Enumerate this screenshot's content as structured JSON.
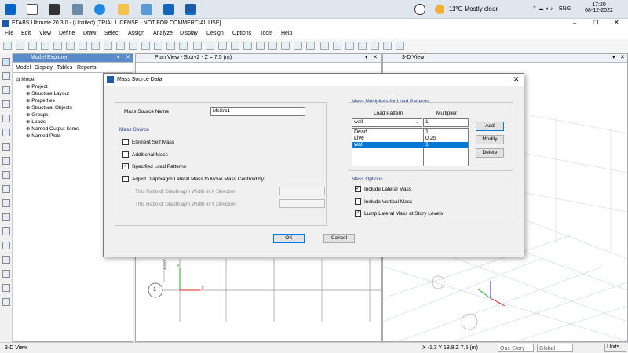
{
  "taskbar": {
    "weather": "11°C  Mostly clear",
    "language": "ENG",
    "time": "17:20",
    "date": "08-12-2022"
  },
  "window": {
    "title": "ETABS Ultimate 20.3.0 - (Untitled)  [TRIAL LICENSE - NOT FOR COMMERCIAL USE]"
  },
  "menu": [
    "File",
    "Edit",
    "View",
    "Define",
    "Draw",
    "Select",
    "Assign",
    "Analyze",
    "Display",
    "Design",
    "Options",
    "Tools",
    "Help"
  ],
  "explorer": {
    "title": "Model Explorer",
    "tabs": [
      "Model",
      "Display",
      "Tables",
      "Reports"
    ],
    "root": "Model",
    "items": [
      "Project",
      "Structure Layout",
      "Properties",
      "Structural Objects",
      "Groups",
      "Loads",
      "Named Output Items",
      "Named Plots"
    ]
  },
  "plan": {
    "title": "Plan View - Story2 - Z = 7.5 (m)",
    "axis_marker": "1",
    "dim_label": "4 (m)"
  },
  "view3d": {
    "title": "3-D View"
  },
  "dialog": {
    "title": "Mass Source Data",
    "name_label": "Mass Source Name",
    "name_value": "MsSrc1",
    "mass_source_title": "Mass Source",
    "options": [
      {
        "label": "Element Self Mass",
        "checked": false
      },
      {
        "label": "Additional Mass",
        "checked": false
      },
      {
        "label": "Specified Load Patterns",
        "checked": true
      },
      {
        "label": "Adjust Diaphragm Lateral Mass to Move Mass Centroid by:",
        "checked": false
      }
    ],
    "ratio_x_label": "This Ratio of Diaphragm Width in X Direction",
    "ratio_y_label": "This Ratio of Diaphragm Width in Y Direction",
    "multipliers_title": "Mass Multipliers for Load Patterns",
    "col_pattern": "Load Pattern",
    "col_multiplier": "Multiplier",
    "input_pattern": "wall",
    "input_multiplier": "1",
    "rows": [
      {
        "pattern": "Dead",
        "multiplier": "1"
      },
      {
        "pattern": "Live",
        "multiplier": "0.25"
      },
      {
        "pattern": "wall",
        "multiplier": "1"
      }
    ],
    "add_label": "Add",
    "modify_label": "Modify",
    "delete_label": "Delete",
    "mass_options_title": "Mass Options",
    "mass_options": [
      {
        "label": "Include Lateral Mass",
        "checked": true
      },
      {
        "label": "Include Vertical Mass",
        "checked": false
      },
      {
        "label": "Lump Lateral Mass at Story Levels",
        "checked": true
      }
    ],
    "ok_label": "OK",
    "cancel_label": "Cancel"
  },
  "status": {
    "left": "3-D View",
    "coords": "X -1.3  Y 18.8  Z 7.5 (m)",
    "story": "One Story",
    "coord_sys": "Global",
    "units": "Units..."
  },
  "colors": {
    "accent": "#0078d7",
    "group_title": "#1a3a8a"
  }
}
